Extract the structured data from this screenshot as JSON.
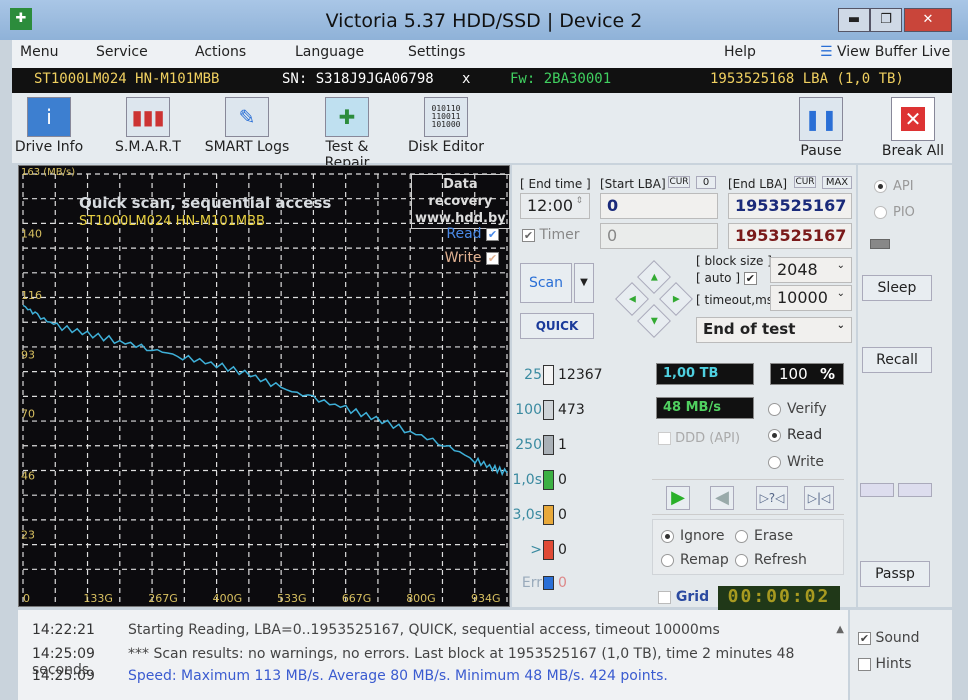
{
  "window": {
    "title": "Victoria 5.37 HDD/SSD | Device 2",
    "minimize": "▬",
    "maximize": "❐",
    "close": "✕"
  },
  "menu": [
    "Menu",
    "Service",
    "Actions",
    "Language",
    "Settings",
    "Help"
  ],
  "view_buffer": "View Buffer Live",
  "drive": {
    "model": "ST1000LM024 HN-M101MBB",
    "serial": "SN: S318J9JGA06798",
    "x": "x",
    "firmware": "Fw: 2BA30001",
    "lba": "1953525168 LBA (1,0 TB)"
  },
  "toolbar": {
    "drive_info": "Drive Info",
    "smart": "S.M.A.R.T",
    "smart_logs": "SMART Logs",
    "test_repair": "Test & Repair",
    "disk_editor": "Disk Editor",
    "pause": "Pause",
    "break_all": "Break All"
  },
  "graph": {
    "title": "Quick scan, sequential access",
    "model": "ST1000LM024 HN-M101MBB",
    "banner1": "Data recovery",
    "banner2": "www.hdd.by",
    "read": "Read",
    "write": "Write"
  },
  "chart_data": {
    "type": "line",
    "ylabel": "163 (MB/s)",
    "ylim": [
      0,
      163
    ],
    "xlim": [
      0,
      1000
    ],
    "y_ticks": [
      "140",
      "116",
      "93",
      "70",
      "46",
      "23"
    ],
    "y_tick_values": [
      140,
      116,
      93,
      70,
      46,
      23
    ],
    "x_ticks": [
      "0",
      "133G",
      "267G",
      "400G",
      "533G",
      "667G",
      "800G",
      "934G"
    ],
    "x_tick_values": [
      0,
      133,
      267,
      400,
      533,
      667,
      800,
      934
    ],
    "series": [
      {
        "name": "Read",
        "color": "#3fb0d8",
        "x": [
          0,
          30,
          70,
          133,
          200,
          267,
          330,
          400,
          470,
          533,
          600,
          667,
          730,
          800,
          870,
          934,
          970,
          1000
        ],
        "y": [
          112,
          108,
          104,
          101,
          98,
          95,
          92,
          89,
          85,
          80,
          76,
          72,
          68,
          63,
          58,
          52,
          49,
          47
        ]
      }
    ]
  },
  "controls": {
    "end_time_label": "[ End time ]",
    "end_time": "12:00",
    "start_lba_label": "[Start LBA]",
    "cur": "CUR",
    "zero": "0",
    "end_lba_label": "[End LBA]",
    "max": "MAX",
    "start_lba": "0",
    "end_lba": "1953525167",
    "timer": "Timer",
    "timer_val": "0",
    "end_lba2": "1953525167",
    "scan": "Scan",
    "quick": "QUICK",
    "block_size_label": "[ block size ]",
    "auto_label": "[ auto ]",
    "block_size": "2048",
    "timeout_label": "[ timeout,ms ]",
    "timeout": "10000",
    "end_action": "End of test"
  },
  "stats": [
    {
      "t": "25",
      "n": "12367",
      "c": "#f4f4f4"
    },
    {
      "t": "100",
      "n": "473",
      "c": "#cfd4d8"
    },
    {
      "t": "250",
      "n": "1",
      "c": "#a9b0b6"
    },
    {
      "t": "1,0s",
      "n": "0",
      "c": "#3cb043"
    },
    {
      "t": "3,0s",
      "n": "0",
      "c": "#e8a93a"
    },
    {
      "t": ">",
      "n": "0",
      "c": "#e04a35"
    },
    {
      "t": "Err",
      "n": "0",
      "c": "#2a6fd6"
    }
  ],
  "progress": {
    "size": "1,00 TB",
    "percent": "100",
    "pct_sign": "%",
    "speed": "48 MB/s",
    "percent_value": 100
  },
  "modes": {
    "verify": "Verify",
    "read": "Read",
    "write": "Write",
    "ddd": "DDD (API)"
  },
  "actions": {
    "ignore": "Ignore",
    "erase": "Erase",
    "remap": "Remap",
    "refresh": "Refresh"
  },
  "grid": "Grid",
  "timer_display": "00:00:02",
  "right": {
    "api": "API",
    "pio": "PIO",
    "sleep": "Sleep",
    "recall": "Recall",
    "passp": "Passp"
  },
  "log": [
    {
      "time": "14:22:21",
      "msg": "Starting Reading, LBA=0..1953525167, QUICK, sequential access, timeout 10000ms",
      "color": "#333"
    },
    {
      "time": "14:25:09",
      "msg": "*** Scan results: no warnings, no errors. Last block at 1953525167 (1,0 TB), time 2 minutes 48 seconds.",
      "color": "#333"
    },
    {
      "time": "14:25:09",
      "msg": "Speed: Maximum 113 MB/s. Average 80 MB/s. Minimum 48 MB/s. 424 points.",
      "color": "#3a5bd0"
    }
  ],
  "sound": "Sound",
  "hints": "Hints"
}
